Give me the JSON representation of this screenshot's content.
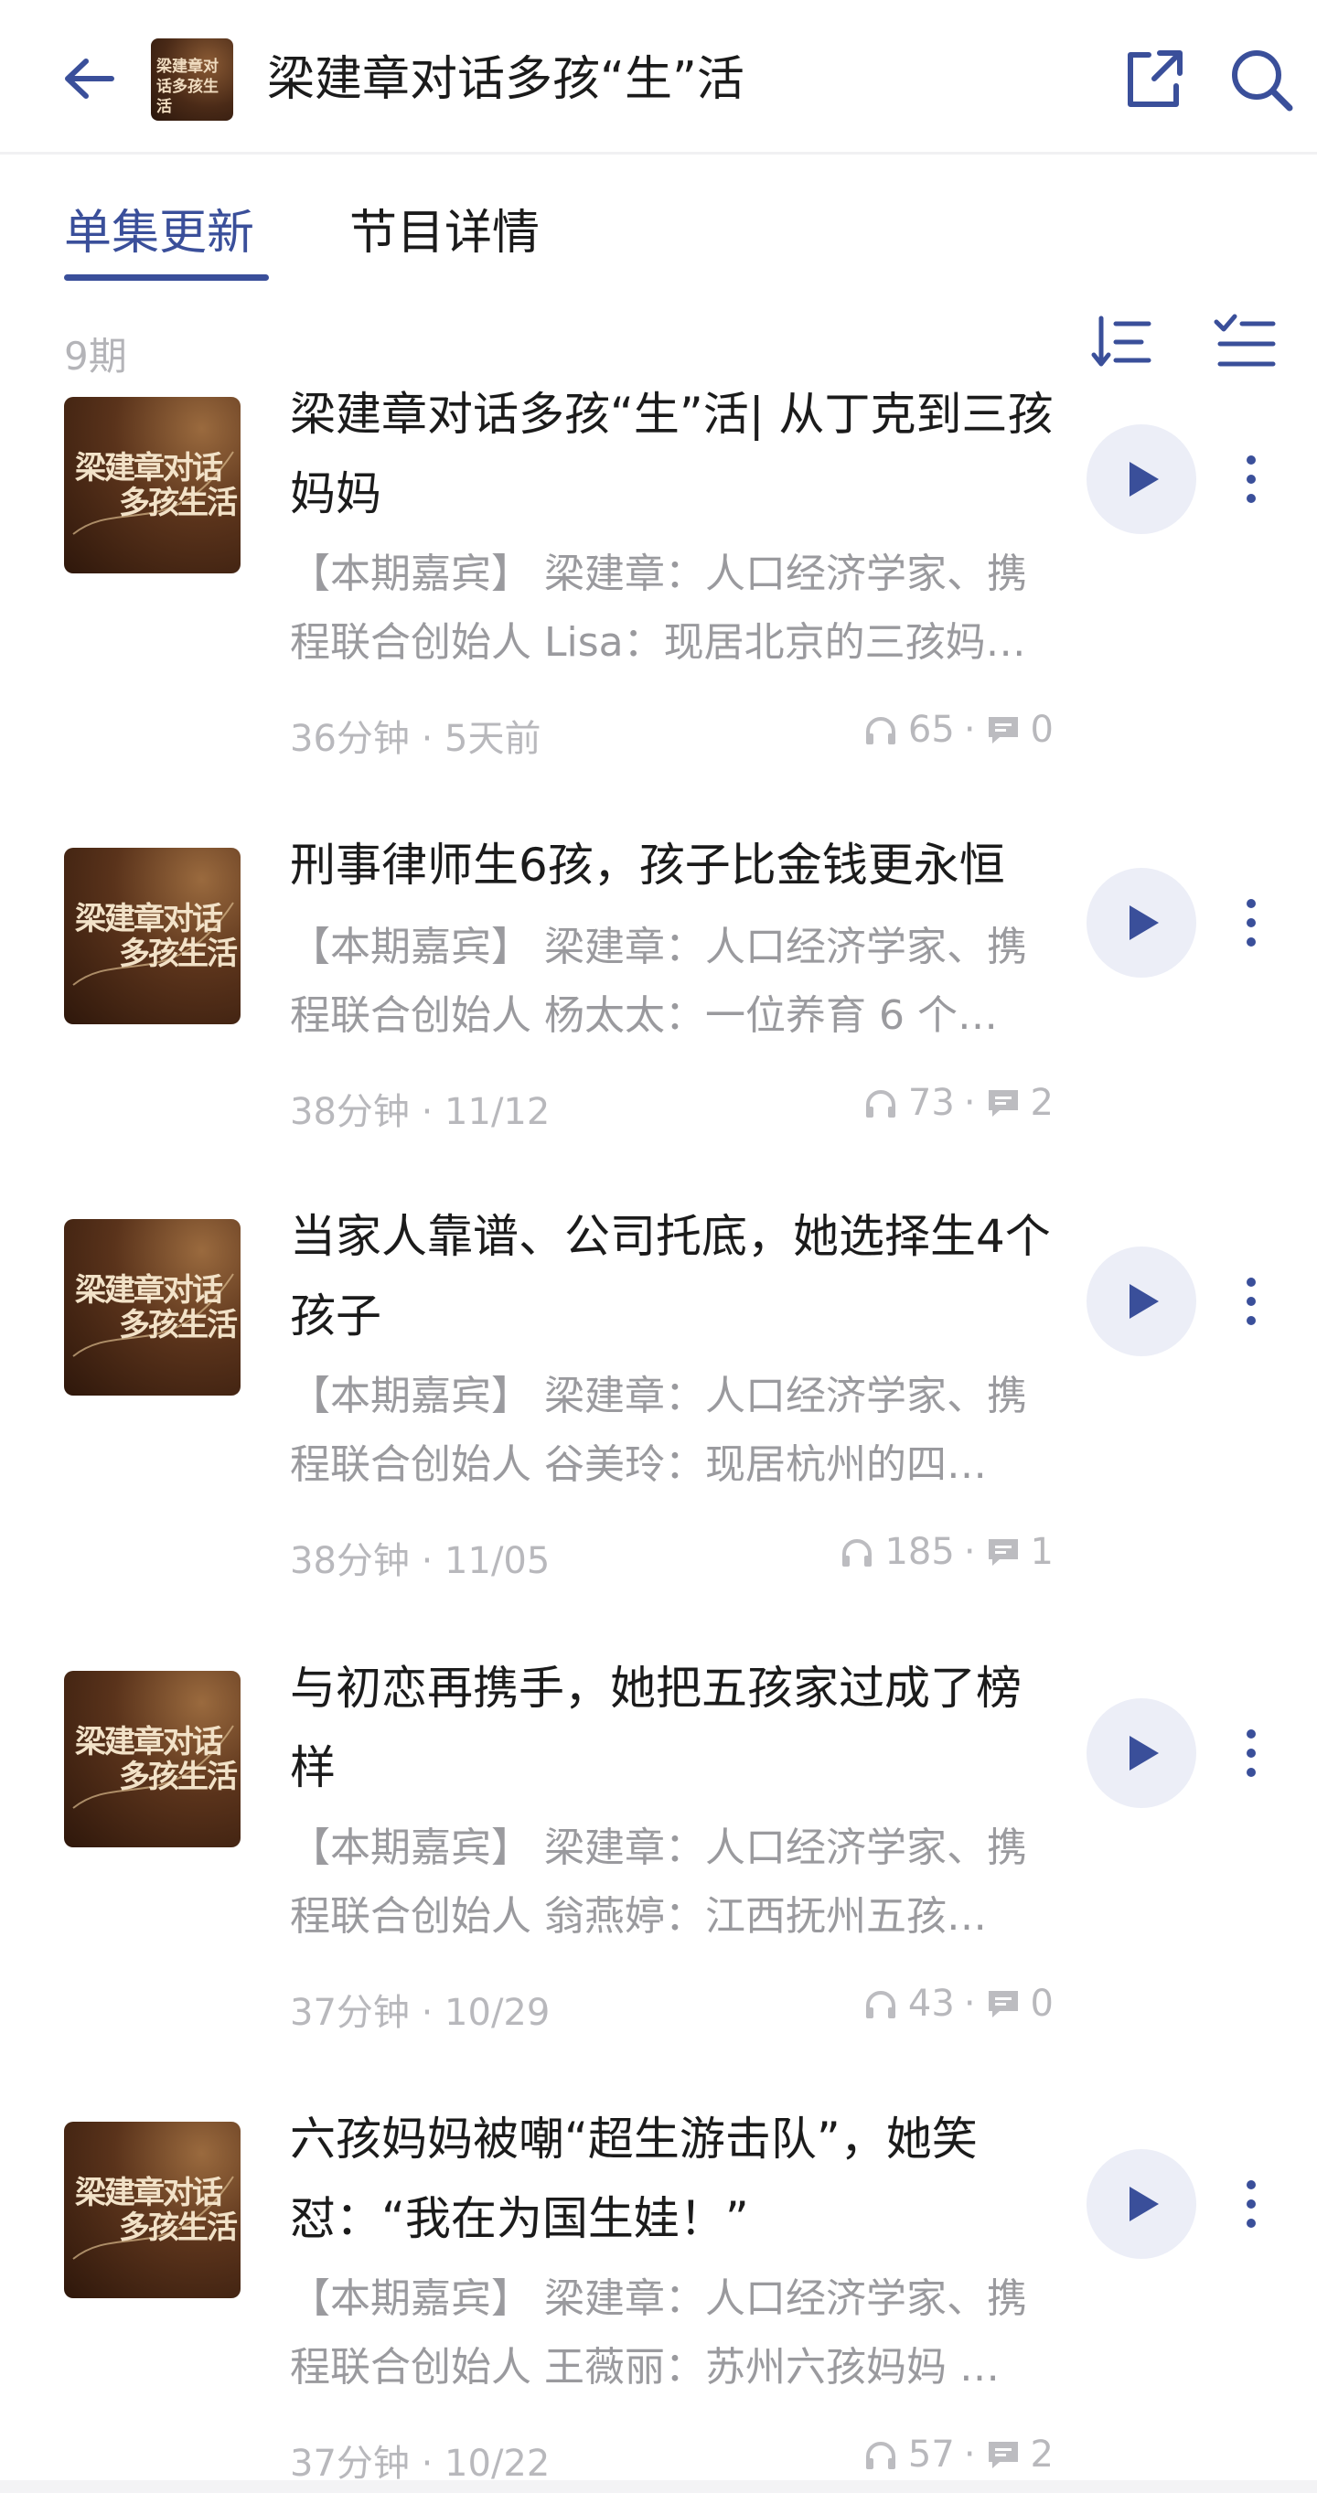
{
  "header": {
    "title": "梁建章对话多孩“生”活",
    "cover_text": "梁建章对话多孩生活"
  },
  "tabs": [
    {
      "label": "单集更新",
      "active": true
    },
    {
      "label": "节目详情",
      "active": false
    }
  ],
  "episode_count": "9期",
  "colors": {
    "accent": "#3a4f9a",
    "muted": "#b8b8bc",
    "play_bg": "#eceef7"
  },
  "cover_art": {
    "line1": "梁建章对话",
    "line2": "多孩生活"
  },
  "episodes": [
    {
      "title": "梁建章对话多孩“生”活| 从丁克到三孩妈妈",
      "desc_line1": "【本期嘉宾】 梁建章：人口经济学家、携",
      "desc_line2": "程联合创始人 Lisa：现居北京的三孩妈…",
      "meta": "36分钟 · 5天前",
      "plays": "65",
      "comments": "0"
    },
    {
      "title": "刑事律师生6孩，孩子比金钱更永恒",
      "desc_line1": "【本期嘉宾】 梁建章：人口经济学家、携",
      "desc_line2": "程联合创始人 杨太太：一位养育 6 个…",
      "meta": "38分钟 · 11/12",
      "plays": "73",
      "comments": "2"
    },
    {
      "title": "当家人靠谱、公司托底，她选择生4个孩子",
      "desc_line1": "【本期嘉宾】 梁建章：人口经济学家、携",
      "desc_line2": "程联合创始人 谷美玲：现居杭州的四…",
      "meta": "38分钟 · 11/05",
      "plays": "185",
      "comments": "1"
    },
    {
      "title": "与初恋再携手，她把五孩家过成了榜样",
      "desc_line1": "【本期嘉宾】 梁建章：人口经济学家、携",
      "desc_line2": "程联合创始人 翁燕婷：江西抚州五孩…",
      "meta": "37分钟 · 10/29",
      "plays": "43",
      "comments": "0"
    },
    {
      "title": "六孩妈妈被嘲“超生游击队”，她笑怼：“我在为国生娃！”",
      "desc_line1": "【本期嘉宾】 梁建章：人口经济学家、携",
      "desc_line2": "程联合创始人 王薇丽：苏州六孩妈妈 …",
      "meta": "37分钟 · 10/22",
      "plays": "57",
      "comments": "2"
    }
  ]
}
